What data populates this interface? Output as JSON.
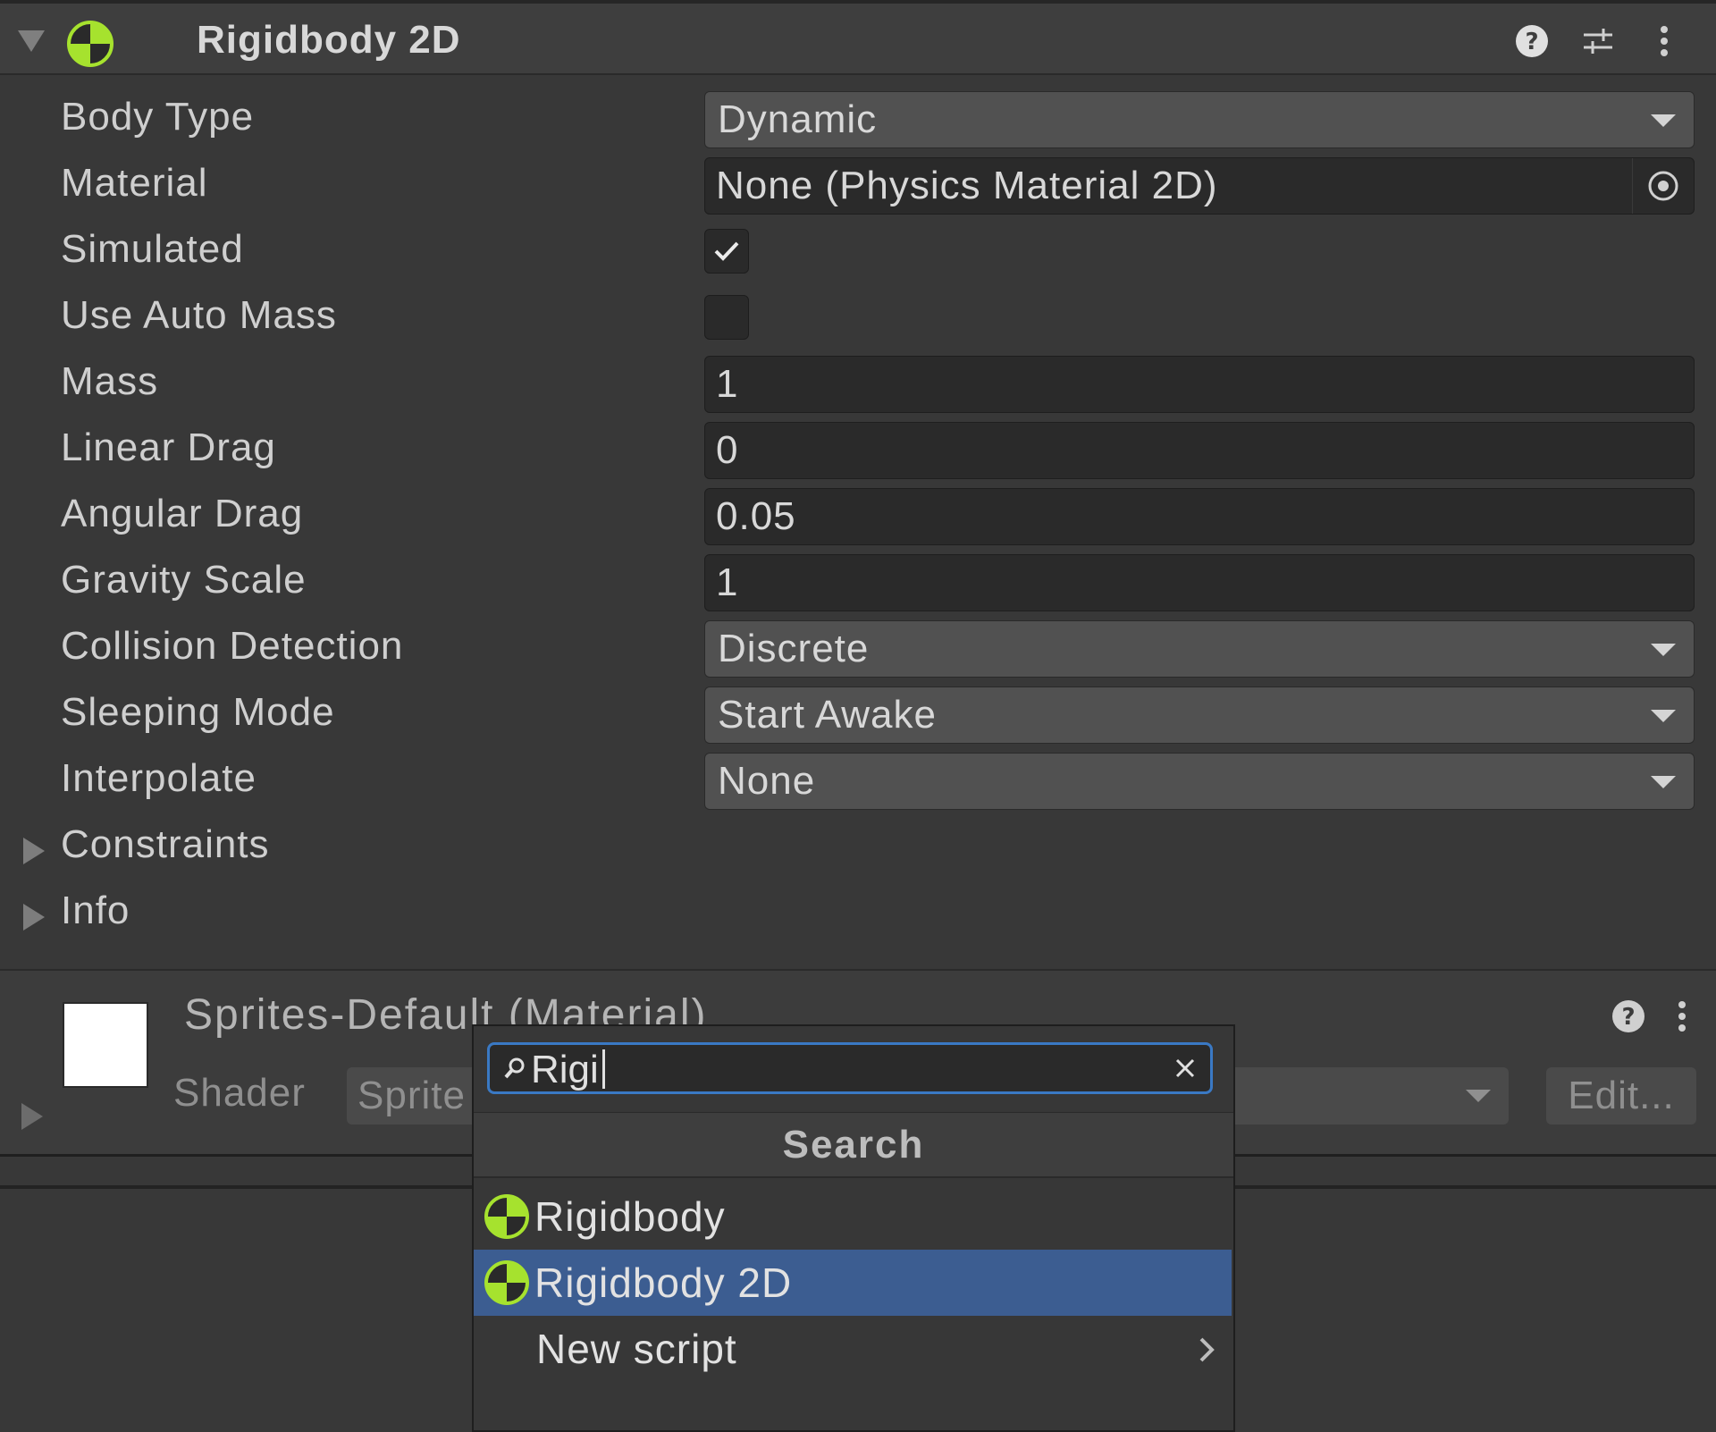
{
  "component": {
    "title": "Rigidbody 2D",
    "header_icons": [
      "help-icon",
      "presets-icon",
      "more-options-icon"
    ]
  },
  "properties": {
    "body_type": {
      "label": "Body Type",
      "value": "Dynamic"
    },
    "material": {
      "label": "Material",
      "value": "None (Physics Material 2D)"
    },
    "simulated": {
      "label": "Simulated",
      "checked": true
    },
    "use_auto_mass": {
      "label": "Use Auto Mass",
      "checked": false
    },
    "mass": {
      "label": "Mass",
      "value": "1"
    },
    "linear_drag": {
      "label": "Linear Drag",
      "value": "0"
    },
    "angular_drag": {
      "label": "Angular Drag",
      "value": "0.05"
    },
    "gravity_scale": {
      "label": "Gravity Scale",
      "value": "1"
    },
    "collision_detection": {
      "label": "Collision Detection",
      "value": "Discrete"
    },
    "sleeping_mode": {
      "label": "Sleeping Mode",
      "value": "Start Awake"
    },
    "interpolate": {
      "label": "Interpolate",
      "value": "None"
    }
  },
  "foldouts": {
    "constraints": "Constraints",
    "info": "Info"
  },
  "material_section": {
    "title": "Sprites-Default (Material)",
    "shader_label": "Shader",
    "shader_value": "Sprite",
    "edit_label": "Edit..."
  },
  "add_component_popup": {
    "search_value": "Rigi",
    "header": "Search",
    "items": [
      {
        "label": "Rigidbody",
        "icon": "rigidbody-icon",
        "selected": false
      },
      {
        "label": "Rigidbody 2D",
        "icon": "rigidbody-icon",
        "selected": true
      },
      {
        "label": "New script",
        "icon": "chevron-right-icon",
        "selected": false
      }
    ]
  },
  "colors": {
    "background": "#383838",
    "selection": "#3c5d91",
    "search_focus": "#3a79c4",
    "rigidbody_icon_green": "#a6e22e"
  }
}
